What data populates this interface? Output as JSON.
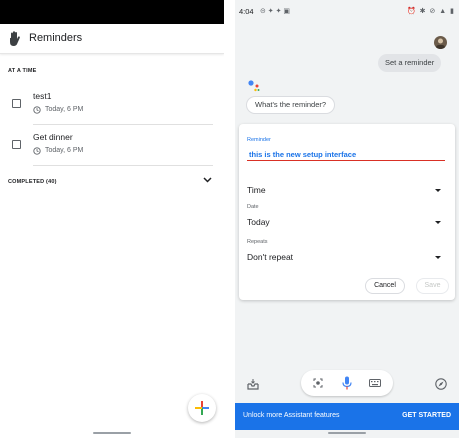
{
  "left": {
    "app_title": "Reminders",
    "section_at_a_time": "AT A TIME",
    "reminders": [
      {
        "name": "test1",
        "time": "Today, 6 PM"
      },
      {
        "name": "Get dinner",
        "time": "Today, 6 PM"
      }
    ],
    "completed_label": "COMPLETED (40)",
    "icons": {
      "app": "hand-icon",
      "expand": "chevron-down-icon",
      "fab": "add-icon"
    }
  },
  "right": {
    "status_time": "4:04",
    "user_message": "Set a reminder",
    "assistant_message": "What's the reminder?",
    "card": {
      "reminder_label": "Reminder",
      "reminder_value": "this is the new setup interface",
      "time_label": "Time",
      "date_label": "Date",
      "date_value": "Today",
      "repeats_label": "Repeats",
      "repeats_value": "Don't repeat",
      "cancel_label": "Cancel",
      "save_label": "Save"
    },
    "banner": {
      "text": "Unlock more Assistant features",
      "button": "GET STARTED"
    }
  },
  "colors": {
    "accent": "#1a73e8",
    "error_underline": "#d93025",
    "assistant_background": "#f1f3f4"
  }
}
